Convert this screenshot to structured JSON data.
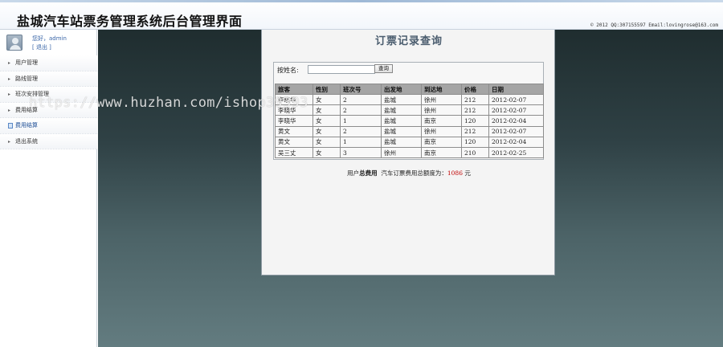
{
  "header": {
    "title": "盐城汽车站票务管理系统后台管理界面",
    "copyright": "© 2012 QQ:307155597 Email:lovingrose@163.com"
  },
  "sidebar": {
    "greeting": "您好，admin",
    "logout": "[ 退出 ]",
    "items": [
      {
        "label": "用户管理",
        "icon": "arrow-right-icon"
      },
      {
        "label": "路线管理",
        "icon": "arrow-right-icon"
      },
      {
        "label": "班次安排管理",
        "icon": "arrow-right-icon"
      },
      {
        "label": "费用结算",
        "icon": "arrow-right-icon"
      },
      {
        "label": "费用结算",
        "icon": "document-icon"
      },
      {
        "label": "退出系统",
        "icon": "arrow-right-icon"
      }
    ]
  },
  "panel": {
    "title": "订票记录查询",
    "search": {
      "label": "按姓名:",
      "value": "",
      "button": "查询"
    },
    "table": {
      "headers": [
        "旅客",
        "性别",
        "班次号",
        "出发地",
        "到达地",
        "价格",
        "日期"
      ],
      "rows": [
        [
          "李晓华",
          "女",
          "2",
          "盐城",
          "徐州",
          "212",
          "2012-02-07"
        ],
        [
          "李晓华",
          "女",
          "2",
          "盐城",
          "徐州",
          "212",
          "2012-02-07"
        ],
        [
          "李晓华",
          "女",
          "1",
          "盐城",
          "南京",
          "120",
          "2012-02-04"
        ],
        [
          "黄文",
          "女",
          "2",
          "盐城",
          "徐州",
          "212",
          "2012-02-07"
        ],
        [
          "黄文",
          "女",
          "1",
          "盐城",
          "南京",
          "120",
          "2012-02-04"
        ],
        [
          "吴三丈",
          "女",
          "3",
          "徐州",
          "南京",
          "210",
          "2012-02-25"
        ]
      ]
    },
    "summary": {
      "prefix": "用户",
      "bold": "总费用",
      "middle": "汽车订票费用总额度为：",
      "amount": "1086",
      "unit": "元"
    }
  },
  "watermark": "https://www.huzhan.com/ishop39393",
  "colors": {
    "accent": "#3a66a8",
    "amount": "#c00000",
    "table_header": "#a5a5a5"
  }
}
